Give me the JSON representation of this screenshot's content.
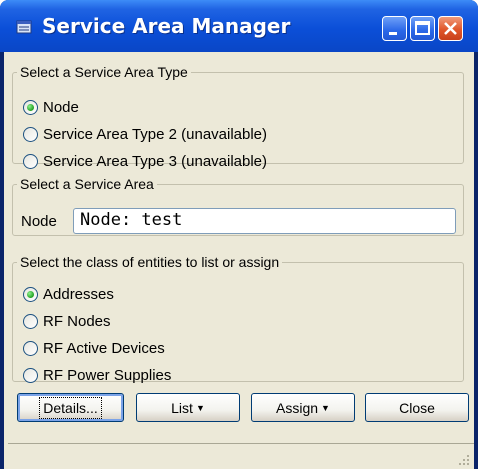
{
  "window": {
    "title": "Service Area Manager"
  },
  "type_group": {
    "legend": "Select a Service Area Type",
    "options": [
      {
        "label": "Node",
        "checked": true
      },
      {
        "label": "Service Area Type 2 (unavailable)",
        "checked": false
      },
      {
        "label": "Service Area Type 3 (unavailable)",
        "checked": false
      }
    ]
  },
  "area_group": {
    "legend": "Select a Service Area",
    "field_label": "Node",
    "field_value": "Node: test"
  },
  "class_group": {
    "legend": "Select the class of entities to list or assign",
    "options": [
      {
        "label": "Addresses",
        "checked": true
      },
      {
        "label": "RF Nodes",
        "checked": false
      },
      {
        "label": "RF Active Devices",
        "checked": false
      },
      {
        "label": "RF Power Supplies",
        "checked": false
      }
    ]
  },
  "buttons": {
    "details": "Details...",
    "list": "List",
    "assign": "Assign",
    "close": "Close"
  },
  "icons": [
    "app-icon",
    "minimize-icon",
    "maximize-icon",
    "close-icon",
    "dropdown-caret-icon",
    "size-grip-icon"
  ]
}
